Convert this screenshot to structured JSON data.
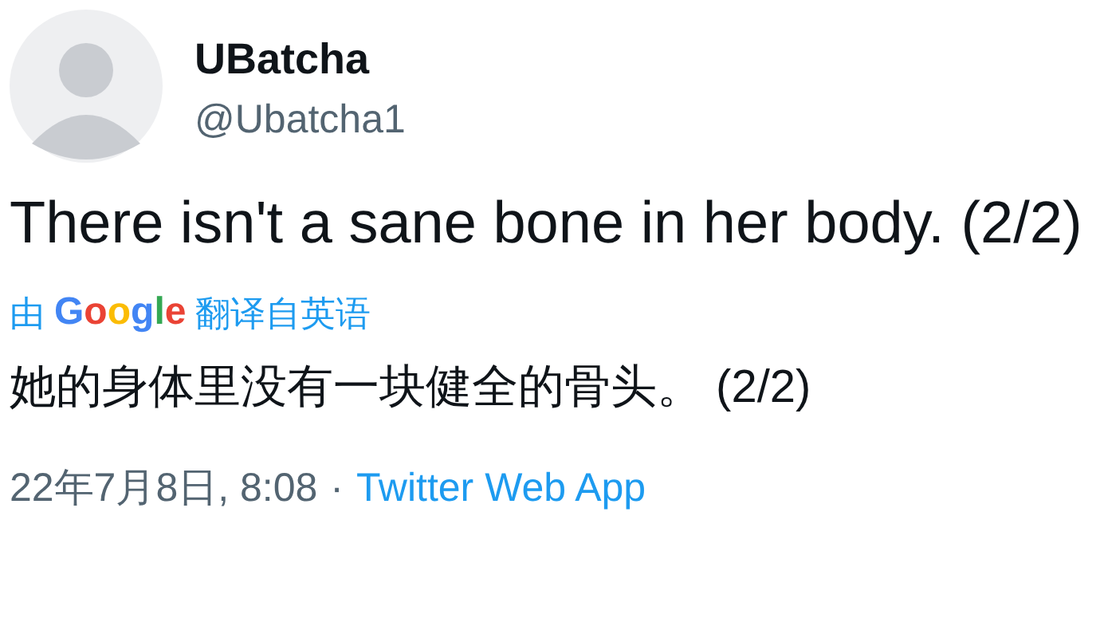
{
  "author": {
    "name": "UBatcha",
    "handle": "@Ubatcha1"
  },
  "tweet": {
    "text": "There isn't a sane bone in her body. (2/2)"
  },
  "translation": {
    "prefix": "由",
    "logo": "Google",
    "suffix": "翻译自英语",
    "text": "她的身体里没有一块健全的骨头。 (2/2)"
  },
  "meta": {
    "timestamp": "22年7月8日, 8:08",
    "separator": "·",
    "source": "Twitter Web App"
  }
}
